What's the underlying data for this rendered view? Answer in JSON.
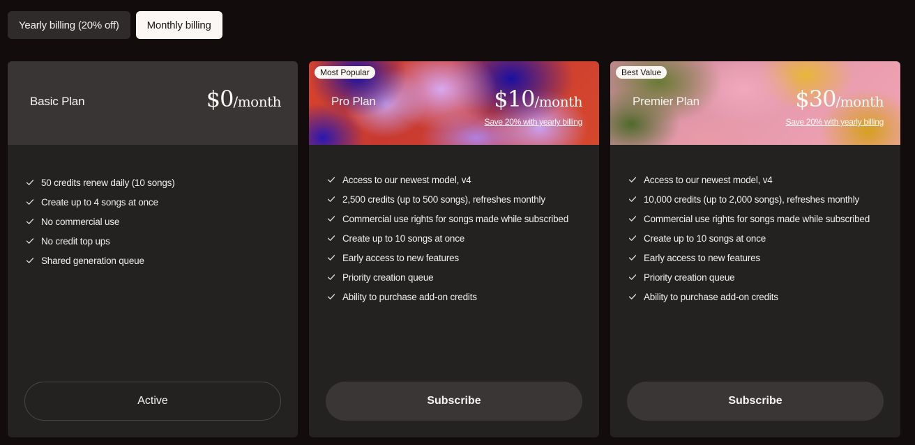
{
  "billing_toggle": {
    "yearly_label": "Yearly billing (20% off)",
    "monthly_label": "Monthly billing",
    "selected": "monthly"
  },
  "plans": [
    {
      "name": "Basic Plan",
      "badge": "",
      "price": "$0",
      "period": "/month",
      "save_note": "",
      "features": [
        "50 credits renew daily (10 songs)",
        "Create up to 4 songs at once",
        "No commercial use",
        "No credit top ups",
        "Shared generation queue"
      ],
      "cta_label": "Active"
    },
    {
      "name": "Pro Plan",
      "badge": "Most Popular",
      "price": "$10",
      "period": "/month",
      "save_note": "Save 20% with yearly billing",
      "features": [
        "Access to our newest model, v4",
        "2,500 credits (up to 500 songs), refreshes monthly",
        "Commercial use rights for songs made while subscribed",
        "Create up to 10 songs at once",
        "Early access to new features",
        "Priority creation queue",
        "Ability to purchase add-on credits"
      ],
      "cta_label": "Subscribe"
    },
    {
      "name": "Premier Plan",
      "badge": "Best Value",
      "price": "$30",
      "period": "/month",
      "save_note": "Save 20% with yearly billing",
      "features": [
        "Access to our newest model, v4",
        "10,000 credits (up to 2,000 songs), refreshes monthly",
        "Commercial use rights for songs made while subscribed",
        "Create up to 10 songs at once",
        "Early access to new features",
        "Priority creation queue",
        "Ability to purchase add-on credits"
      ],
      "cta_label": "Subscribe"
    }
  ],
  "icons": {
    "feature_check": "check-icon"
  },
  "colors": {
    "background": "#120d0c",
    "card": "#242221",
    "active_toggle": "#fbf7f4"
  }
}
